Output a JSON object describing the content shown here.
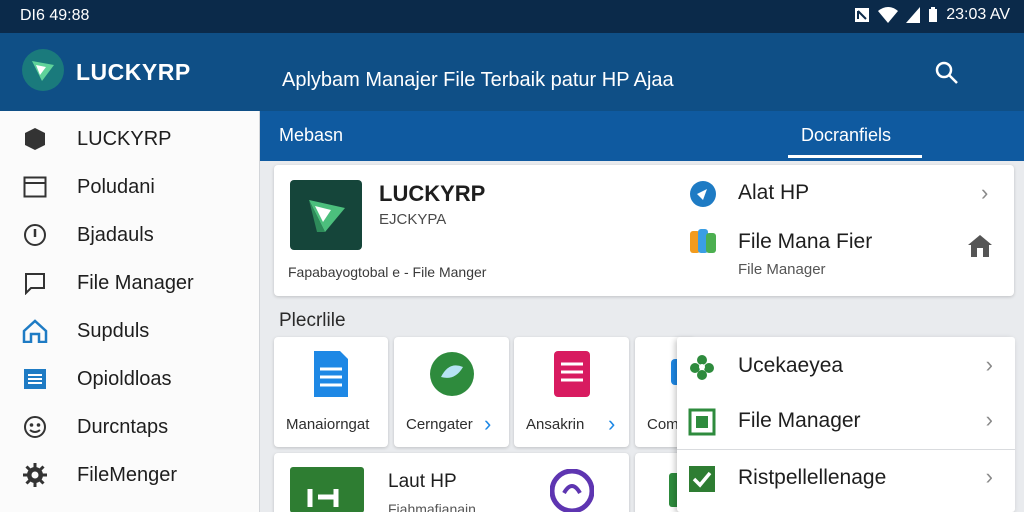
{
  "status": {
    "time_left": "DI6 49:88",
    "time_right": "23:03 AV"
  },
  "app": {
    "name": "LUCKYRP",
    "subtitle": "Aplybam Manajer File Terbaik patur HP Ajaa"
  },
  "drawer": {
    "items": [
      {
        "label": "LUCKYRP",
        "icon": "hexagon-icon"
      },
      {
        "label": "Poludani",
        "icon": "window-icon"
      },
      {
        "label": "Bjadauls",
        "icon": "info-icon"
      },
      {
        "label": "File Manager",
        "icon": "chat-bubble-icon"
      },
      {
        "label": "Supduls",
        "icon": "home-icon"
      },
      {
        "label": "Opioldloas",
        "icon": "list-icon"
      },
      {
        "label": "Durcntaps",
        "icon": "face-icon"
      },
      {
        "label": "FileMenger",
        "icon": "gear-icon"
      }
    ]
  },
  "tabs": [
    {
      "label": "Mebasn"
    },
    {
      "label": "Docranfiels"
    }
  ],
  "featured": {
    "title": "LUCKYRP",
    "subtitle": "EJCKYPA",
    "footer": "Fapabayogtobal e - File Manger"
  },
  "right_list": [
    {
      "title": "Alat HP",
      "subtitle": "",
      "icon": "compass-icon"
    },
    {
      "title": "File Mana Fier",
      "subtitle": "File Manager",
      "icon": "colorful-app-icon"
    }
  ],
  "section_title": "Plecrlile",
  "tiles": [
    {
      "label": "Manaiorngat",
      "icon": "document-icon"
    },
    {
      "label": "Cerngater",
      "icon": "green-circle-icon"
    },
    {
      "label": "Ansakrin",
      "icon": "notes-icon"
    },
    {
      "label": "Com",
      "icon": "blue-app-icon"
    }
  ],
  "bottom_tiles": [
    {
      "title": "Laut HP",
      "subtitle": "Fiahmafianain"
    }
  ],
  "popup": {
    "items": [
      {
        "label": "Ucekaeyea",
        "icon": "leaf-icon"
      },
      {
        "label": "File Manager",
        "icon": "box-icon"
      },
      {
        "label": "Ristpellellenage",
        "icon": "check-icon"
      }
    ]
  },
  "colors": {
    "statusbar": "#0b2a4a",
    "appbar": "#0f4f86",
    "tabbar": "#0f5aa0",
    "accent_green": "#2e8b3d"
  }
}
